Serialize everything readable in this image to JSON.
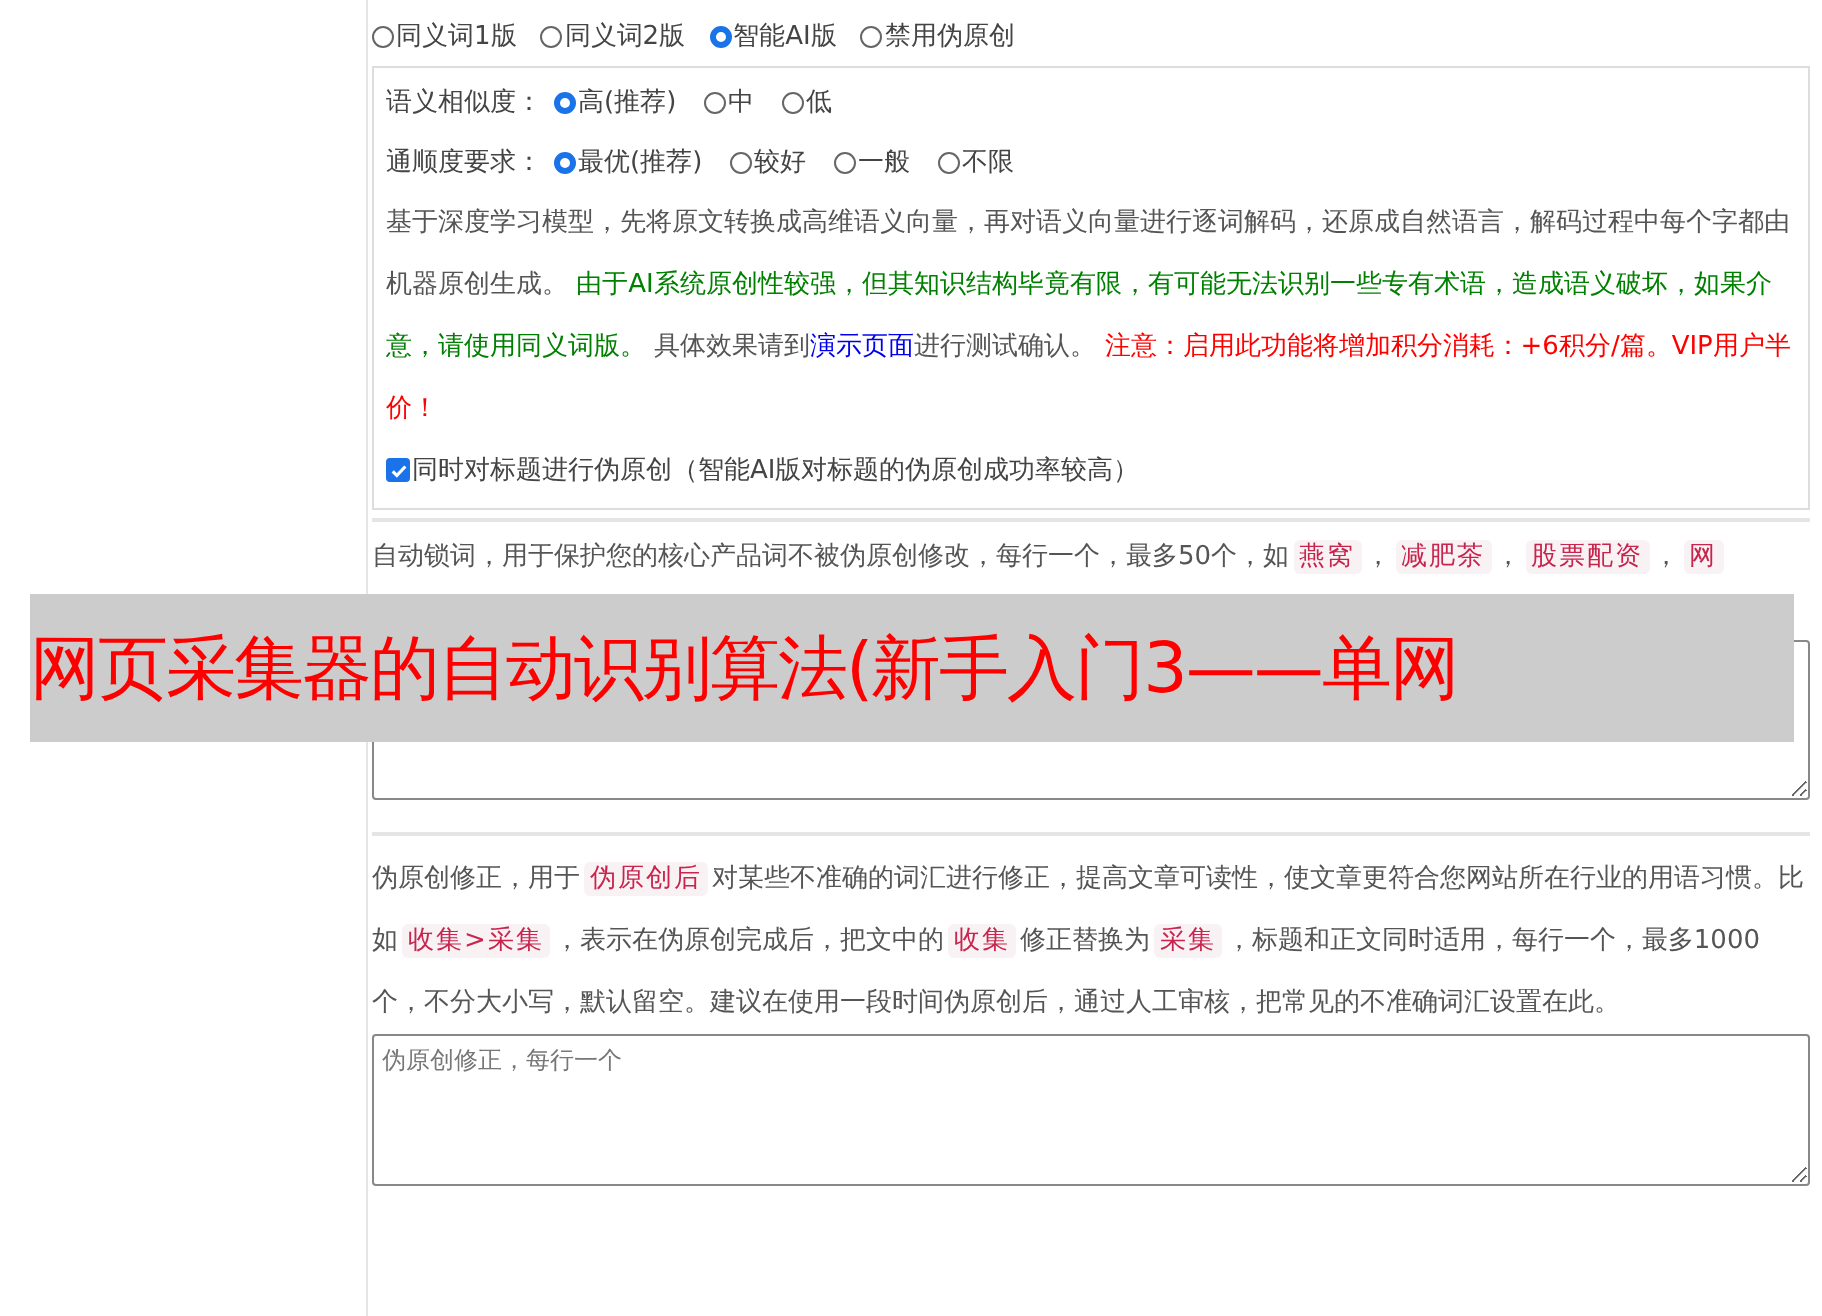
{
  "modes": [
    {
      "label": "同义词1版",
      "selected": false
    },
    {
      "label": "同义词2版",
      "selected": false
    },
    {
      "label": "智能AI版",
      "selected": true
    },
    {
      "label": "禁用伪原创",
      "selected": false
    }
  ],
  "similarity": {
    "label": "语义相似度：",
    "options": [
      {
        "label": "高(推荐)",
        "selected": true
      },
      {
        "label": "中",
        "selected": false
      },
      {
        "label": "低",
        "selected": false
      }
    ]
  },
  "fluency": {
    "label": "通顺度要求：",
    "options": [
      {
        "label": "最优(推荐)",
        "selected": true
      },
      {
        "label": "较好",
        "selected": false
      },
      {
        "label": "一般",
        "selected": false
      },
      {
        "label": "不限",
        "selected": false
      }
    ]
  },
  "description": [
    {
      "kind": "plain",
      "text": "基于深度学习模型，先将原文转换成高维语义向量，再对语义向量进行逐词解码，还原成自然语言，解码过程中每个字都由机器原创生成。 "
    },
    {
      "kind": "green",
      "text": "由于AI系统原创性较强，但其知识结构毕竟有限，有可能无法识别一些专有术语，造成语义破坏，如果介意，请使用同义词版。"
    },
    {
      "kind": "plain",
      "text": " 具体效果请到"
    },
    {
      "kind": "link",
      "text": "演示页面"
    },
    {
      "kind": "plain",
      "text": "进行测试确认。 "
    },
    {
      "kind": "red",
      "text": "注意：启用此功能将增加积分消耗：+6积分/篇。VIP用户半价！"
    }
  ],
  "title_option": {
    "label": "同时对标题进行伪原创（智能AI版对标题的伪原创成功率较高）",
    "checked": true
  },
  "lock_words": {
    "segments": [
      {
        "kind": "plain",
        "text": "自动锁词，用于保护您的核心产品词不被伪原创修改，每行一个，最多50个，如"
      },
      {
        "kind": "tag",
        "text": "燕窝"
      },
      {
        "kind": "plain",
        "text": "，"
      },
      {
        "kind": "tag",
        "text": "减肥茶"
      },
      {
        "kind": "plain",
        "text": "，"
      },
      {
        "kind": "tag",
        "text": "股票配资"
      },
      {
        "kind": "plain",
        "text": "，"
      },
      {
        "kind": "tag",
        "text": "网"
      }
    ]
  },
  "correction": {
    "segments": [
      {
        "kind": "plain",
        "text": "伪原创修正，用于"
      },
      {
        "kind": "tag",
        "text": "伪原创后"
      },
      {
        "kind": "plain",
        "text": "对某些不准确的词汇进行修正，提高文章可读性，使文章更符合您网站所在行业的用语习惯。比如"
      },
      {
        "kind": "tag",
        "text": "收集>采集"
      },
      {
        "kind": "plain",
        "text": "，表示在伪原创完成后，把文中的"
      },
      {
        "kind": "tag",
        "text": "收集"
      },
      {
        "kind": "plain",
        "text": "修正替换为"
      },
      {
        "kind": "tag",
        "text": "采集"
      },
      {
        "kind": "plain",
        "text": "，标题和正文同时适用，每行一个，最多1000个，不分大小写，默认留空。建议在使用一段时间伪原创后，通过人工审核，把常见的不准确词汇设置在此。"
      }
    ],
    "placeholder": "伪原创修正，每行一个"
  },
  "banner": {
    "text": "网页采集器的自动识别算法(新手入门3——单网"
  }
}
